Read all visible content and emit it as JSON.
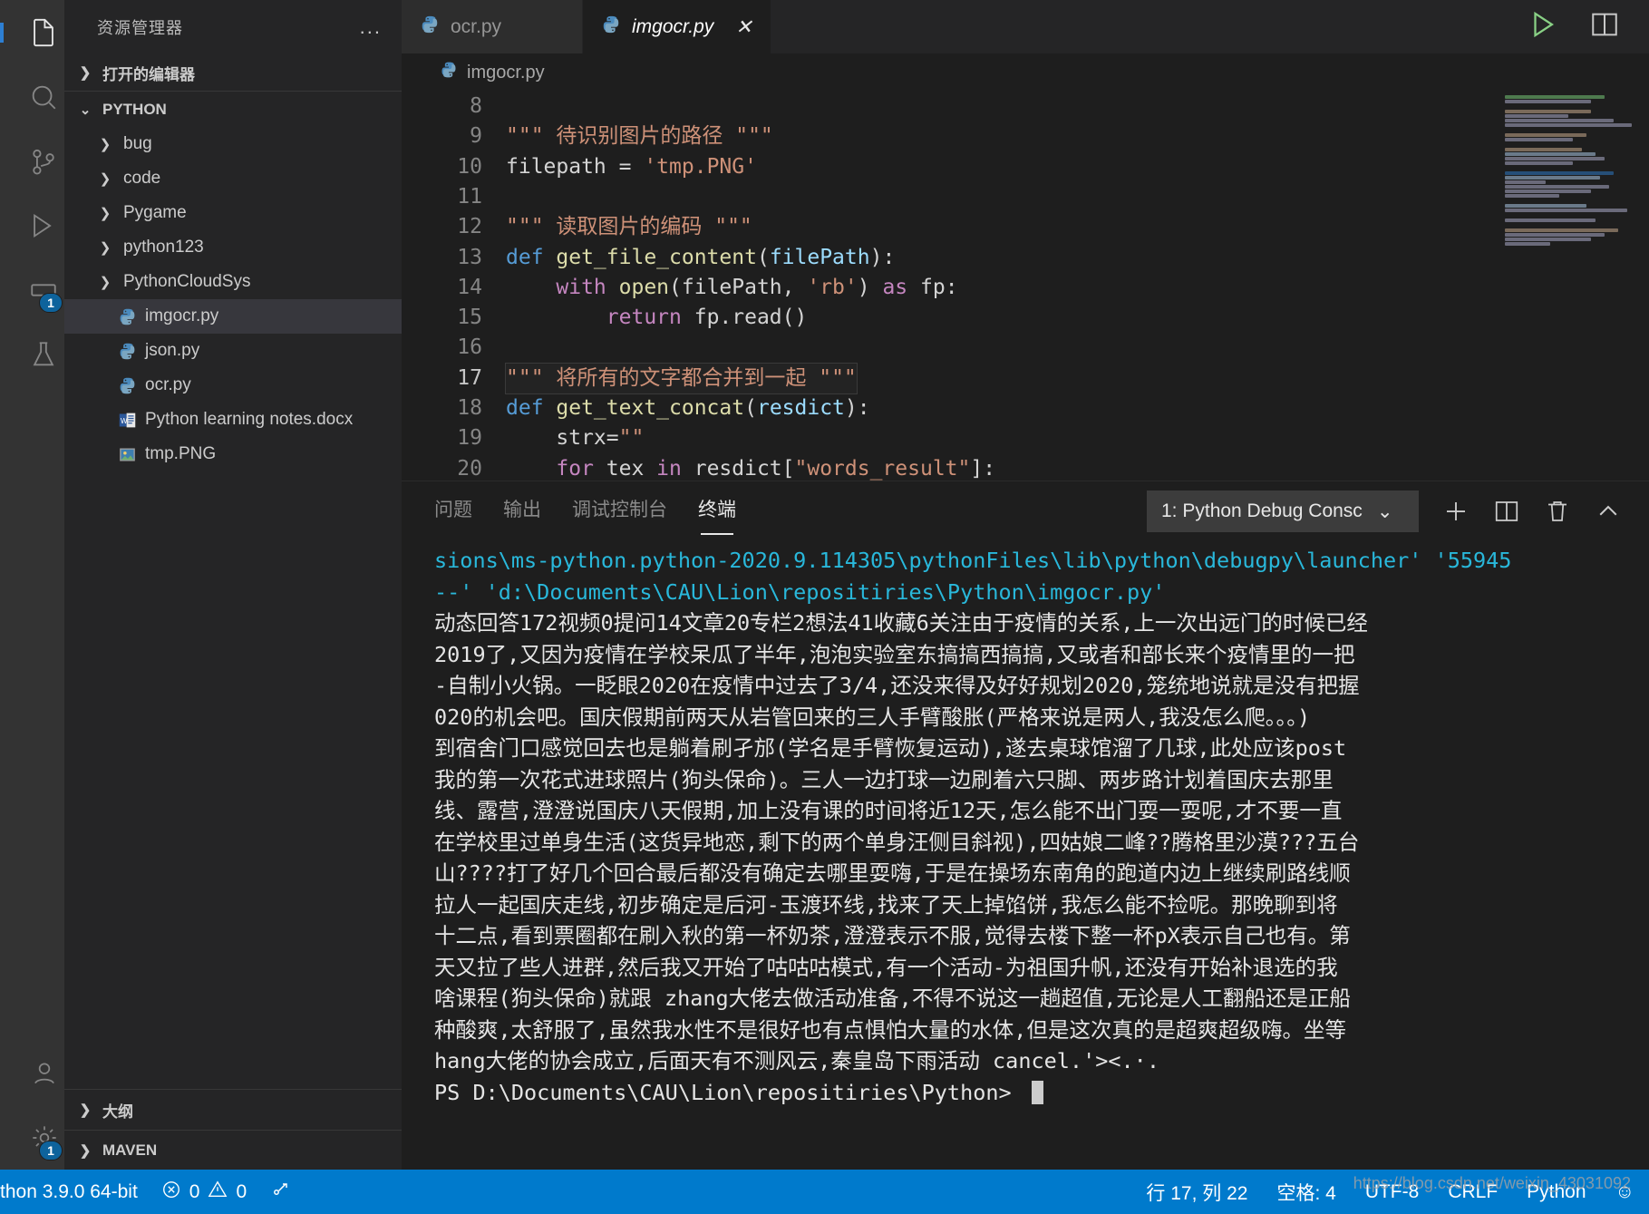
{
  "activitybar": {
    "items": [
      {
        "name": "explorer",
        "icon": "files-icon",
        "active": true,
        "badge": null
      },
      {
        "name": "search",
        "icon": "search-icon",
        "active": false,
        "badge": null
      },
      {
        "name": "source-control",
        "icon": "source-control-icon",
        "active": false,
        "badge": null
      },
      {
        "name": "run-debug",
        "icon": "run-debug-icon",
        "active": false,
        "badge": null
      },
      {
        "name": "extensions",
        "icon": "extensions-icon",
        "active": false,
        "badge": "1"
      },
      {
        "name": "testing",
        "icon": "beaker-icon",
        "active": false,
        "badge": null
      }
    ],
    "bottom": [
      {
        "name": "accounts",
        "icon": "account-icon",
        "badge": null
      },
      {
        "name": "settings",
        "icon": "gear-icon",
        "badge": "1"
      }
    ]
  },
  "sidebar": {
    "title": "资源管理器",
    "more_actions": "...",
    "open_editors": {
      "label": "打开的编辑器",
      "expanded": false
    },
    "workspace": {
      "label": "PYTHON",
      "expanded": true
    },
    "tree": [
      {
        "label": "bug",
        "type": "folder",
        "expanded": false,
        "indent": 1
      },
      {
        "label": "code",
        "type": "folder",
        "expanded": false,
        "indent": 1
      },
      {
        "label": "Pygame",
        "type": "folder",
        "expanded": false,
        "indent": 1
      },
      {
        "label": "python123",
        "type": "folder",
        "expanded": false,
        "indent": 1
      },
      {
        "label": "PythonCloudSys",
        "type": "folder",
        "expanded": false,
        "indent": 1
      },
      {
        "label": "imgocr.py",
        "type": "python",
        "selected": true,
        "indent": 1
      },
      {
        "label": "json.py",
        "type": "python",
        "selected": false,
        "indent": 1
      },
      {
        "label": "ocr.py",
        "type": "python",
        "selected": false,
        "indent": 1
      },
      {
        "label": "Python learning notes.docx",
        "type": "word",
        "selected": false,
        "indent": 1
      },
      {
        "label": "tmp.PNG",
        "type": "image",
        "selected": false,
        "indent": 1
      }
    ],
    "outline": {
      "label": "大纲",
      "expanded": false
    },
    "maven": {
      "label": "MAVEN",
      "expanded": false
    }
  },
  "tabs": [
    {
      "label": "ocr.py",
      "icon": "python-icon",
      "active": false,
      "dirty": false,
      "closable": false
    },
    {
      "label": "imgocr.py",
      "icon": "python-icon",
      "active": true,
      "dirty": false,
      "closable": true,
      "close_glyph": "✕"
    }
  ],
  "editor_actions": [
    {
      "name": "run-python-file-button",
      "icon": "play-icon",
      "color": "#89d185"
    },
    {
      "name": "split-editor-right-button",
      "icon": "split-editor-icon",
      "color": "#c8c8c8"
    }
  ],
  "breadcrumb": {
    "icon": "python-icon",
    "label": "imgocr.py"
  },
  "code": {
    "lines": [
      {
        "num": "8",
        "tokens": []
      },
      {
        "num": "9",
        "tokens": [
          {
            "t": "\"\"\" 待识别图片的路径 \"\"\"",
            "c": "k-doc"
          }
        ]
      },
      {
        "num": "10",
        "tokens": [
          {
            "t": "filepath ",
            "c": "k-pl"
          },
          {
            "t": "= ",
            "c": "k-pl"
          },
          {
            "t": "'tmp.PNG'",
            "c": "k-str"
          }
        ]
      },
      {
        "num": "11",
        "tokens": []
      },
      {
        "num": "12",
        "tokens": [
          {
            "t": "\"\"\" 读取图片的编码 \"\"\"",
            "c": "k-doc"
          }
        ]
      },
      {
        "num": "13",
        "tokens": [
          {
            "t": "def ",
            "c": "k-kw"
          },
          {
            "t": "get_file_content",
            "c": "k-fn"
          },
          {
            "t": "(",
            "c": "k-pl"
          },
          {
            "t": "filePath",
            "c": "k-par"
          },
          {
            "t": "):",
            "c": "k-pl"
          }
        ]
      },
      {
        "num": "14",
        "tokens": [
          {
            "t": "    ",
            "c": "k-pl"
          },
          {
            "t": "with ",
            "c": "k-ctl"
          },
          {
            "t": "open",
            "c": "k-fn"
          },
          {
            "t": "(filePath, ",
            "c": "k-pl"
          },
          {
            "t": "'rb'",
            "c": "k-str"
          },
          {
            "t": ") ",
            "c": "k-pl"
          },
          {
            "t": "as ",
            "c": "k-ctl"
          },
          {
            "t": "fp:",
            "c": "k-pl"
          }
        ]
      },
      {
        "num": "15",
        "tokens": [
          {
            "t": "        ",
            "c": "k-pl"
          },
          {
            "t": "return ",
            "c": "k-ctl"
          },
          {
            "t": "fp.read()",
            "c": "k-pl"
          }
        ]
      },
      {
        "num": "16",
        "tokens": []
      },
      {
        "num": "17",
        "tokens": [
          {
            "t": "\"\"\" 将所有的文字都合并到一起 \"\"\"",
            "c": "k-doc"
          }
        ],
        "highlight": true,
        "current": true
      },
      {
        "num": "18",
        "tokens": [
          {
            "t": "def ",
            "c": "k-kw"
          },
          {
            "t": "get_text_concat",
            "c": "k-fn"
          },
          {
            "t": "(",
            "c": "k-pl"
          },
          {
            "t": "resdict",
            "c": "k-par"
          },
          {
            "t": "):",
            "c": "k-pl"
          }
        ]
      },
      {
        "num": "19",
        "tokens": [
          {
            "t": "    strx=",
            "c": "k-pl"
          },
          {
            "t": "\"\"",
            "c": "k-str"
          }
        ]
      },
      {
        "num": "20",
        "tokens": [
          {
            "t": "    ",
            "c": "k-pl"
          },
          {
            "t": "for ",
            "c": "k-ctl"
          },
          {
            "t": "tex ",
            "c": "k-pl"
          },
          {
            "t": "in ",
            "c": "k-ctl"
          },
          {
            "t": "resdict[",
            "c": "k-pl"
          },
          {
            "t": "\"words_result\"",
            "c": "k-str"
          },
          {
            "t": "]:",
            "c": "k-pl"
          }
        ]
      }
    ]
  },
  "panel": {
    "tabs": [
      {
        "label": "问题",
        "active": false
      },
      {
        "label": "输出",
        "active": false
      },
      {
        "label": "调试控制台",
        "active": false
      },
      {
        "label": "终端",
        "active": true
      }
    ],
    "terminal_select": {
      "value": "1: Python Debug Consc",
      "chevron": "⌄"
    },
    "actions": [
      {
        "name": "new-terminal-button",
        "glyph": "＋"
      },
      {
        "name": "split-terminal-button",
        "glyph": "▯▯"
      },
      {
        "name": "kill-terminal-button",
        "glyph": "🗑"
      },
      {
        "name": "collapse-panel-button",
        "glyph": "⌃"
      }
    ]
  },
  "terminal": {
    "lines": [
      {
        "c": "cyan",
        "t": "sions\\ms-python.python-2020.9.114305\\pythonFiles\\lib\\python\\debugpy\\launcher' '55945"
      },
      {
        "c": "cyan",
        "t": "--' 'd:\\Documents\\CAU\\Lion\\repositiries\\Python\\imgocr.py'"
      },
      {
        "c": "white",
        "t": "动态回答172视频0提问14文章20专栏2想法41收藏6关注由于疫情的关系,上一次出远门的时候已经"
      },
      {
        "c": "white",
        "t": "2019了,又因为疫情在学校呆瓜了半年,泡泡实验室东搞搞西搞搞,又或者和部长来个疫情里的一把"
      },
      {
        "c": "white",
        "t": "-自制小火锅。一眨眼2020在疫情中过去了3/4,还没来得及好好规划2020,笼统地说就是没有把握"
      },
      {
        "c": "white",
        "t": "020的机会吧。国庆假期前两天从岩管回来的三人手臂酸胀(严格来说是两人,我没怎么爬。。。)"
      },
      {
        "c": "white",
        "t": "到宿舍门口感觉回去也是躺着刷孑邡(学名是手臂恢复运动),遂去桌球馆溜了几球,此处应该post"
      },
      {
        "c": "white",
        "t": "我的第一次花式进球照片(狗头保命)。三人一边打球一边刷着六只脚、两步路计划着国庆去那里"
      },
      {
        "c": "white",
        "t": "线、露营,澄澄说国庆八天假期,加上没有课的时间将近12天,怎么能不出门耍一耍呢,才不要一直"
      },
      {
        "c": "white",
        "t": "在学校里过单身生活(这货异地恋,剩下的两个单身汪侧目斜视),四姑娘二峰??腾格里沙漠???五台"
      },
      {
        "c": "white",
        "t": "山????打了好几个回合最后都没有确定去哪里耍嗨,于是在操场东南角的跑道内边上继续刷路线顺"
      },
      {
        "c": "white",
        "t": "拉人一起国庆走线,初步确定是后河-玉渡环线,找来了天上掉馅饼,我怎么能不捡呢。那晚聊到将"
      },
      {
        "c": "white",
        "t": "十二点,看到票圈都在刷入秋的第一杯奶茶,澄澄表示不服,觉得去楼下整一杯pX表示自己也有。第"
      },
      {
        "c": "white",
        "t": "天又拉了些人进群,然后我又开始了咕咕咕模式,有一个活动-为祖国升帆,还没有开始补退选的我"
      },
      {
        "c": "white",
        "t": "啥课程(狗头保命)就跟 zhang大佬去做活动准备,不得不说这一趟超值,无论是人工翻船还是正船"
      },
      {
        "c": "white",
        "t": "种酸爽,太舒服了,虽然我水性不是很好也有点惧怕大量的水体,但是这次真的是超爽超级嗨。坐等"
      },
      {
        "c": "white",
        "t": "hang大佬的协会成立,后面天有不测风云,秦皇岛下雨活动 cancel.'><.·."
      },
      {
        "c": "white",
        "t": "PS D:\\Documents\\CAU\\Lion\\repositiries\\Python> ",
        "cursor": true
      }
    ]
  },
  "statusbar": {
    "left": [
      {
        "name": "python-interpreter",
        "text": "thon 3.9.0 64-bit"
      },
      {
        "name": "problems",
        "text": "0",
        "icon": "error-icon",
        "icon2": "warning-icon",
        "text2": "0"
      },
      {
        "name": "remote-indicator",
        "icon": "broadcast-icon"
      }
    ],
    "right": [
      {
        "name": "cursor-position",
        "text": "行 17, 列 22"
      },
      {
        "name": "indentation",
        "text": "空格: 4"
      },
      {
        "name": "encoding",
        "text": "UTF-8"
      },
      {
        "name": "eol",
        "text": "CRLF"
      },
      {
        "name": "language-mode",
        "text": "Python"
      },
      {
        "name": "feedback",
        "text": "☺"
      }
    ]
  },
  "watermark": "https://blog.csdn.net/weixin_43031092",
  "colors": {
    "accent": "#007acc",
    "sidebar_bg": "#252526",
    "editor_bg": "#1e1e1e",
    "activitybar_bg": "#333333",
    "badge": "#0e639c",
    "run_green": "#89d185",
    "terminal_cyan": "#29b8db"
  }
}
